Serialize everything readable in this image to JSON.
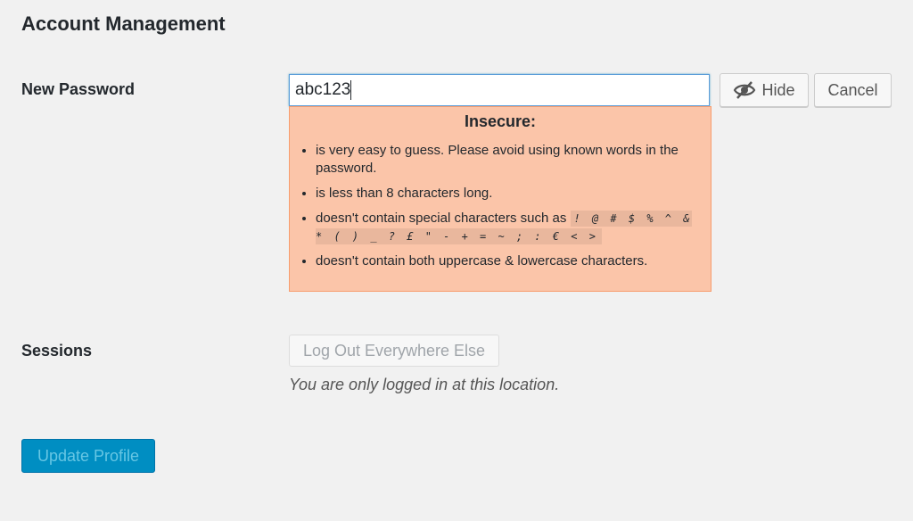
{
  "section_title": "Account Management",
  "password": {
    "label": "New Password",
    "value": "abc123",
    "hide_label": "Hide",
    "cancel_label": "Cancel"
  },
  "strength": {
    "title": "Insecure:",
    "items": [
      "is very easy to guess. Please avoid using known words in the password.",
      "is less than 8 characters long.",
      "doesn't contain special characters such as",
      "doesn't contain both uppercase & lowercase characters."
    ],
    "special_chars": "! @ # $ % ^ & * ( ) _ ? £ \" - + = ~ ; : € < >",
    "color": "#fbc5a9"
  },
  "sessions": {
    "label": "Sessions",
    "button": "Log Out Everywhere Else",
    "note": "You are only logged in at this location."
  },
  "update_button": "Update Profile"
}
